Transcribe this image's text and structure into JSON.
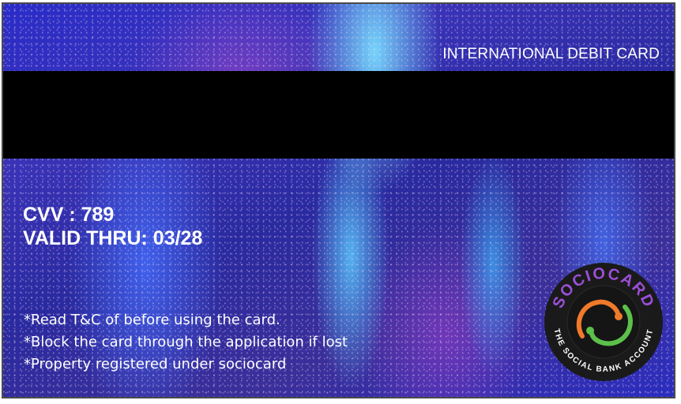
{
  "card": {
    "type_label": "INTERNATIONAL DEBIT CARD",
    "cvv_label": "CVV : 789",
    "valid_thru_label": "VALID THRU: 03/28",
    "notes": [
      "*Read T&C of before using the card.",
      "*Block the card through the application if lost",
      "*Property registered under sociocard"
    ]
  },
  "logo": {
    "icon": "sociocard-logo-icon",
    "brand_text": "SOCIOCARD",
    "tagline": "THE SOCIAL BANK ACCOUNT",
    "colors": {
      "ring": "#1a1a1a",
      "brand": "#9b4fd8",
      "orange": "#f07a2a",
      "green": "#5cc04a"
    }
  }
}
